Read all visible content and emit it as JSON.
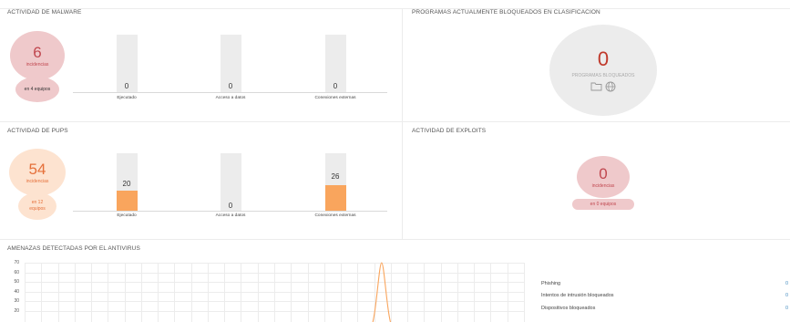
{
  "panels": {
    "malware": {
      "title": "ACTIVIDAD DE MALWARE",
      "count": "6",
      "count_label": "incidencias",
      "devices": "en 4 equipos",
      "bars": [
        {
          "label": "Ejecutado",
          "value": "0",
          "fill": 0
        },
        {
          "label": "Acceso a datos",
          "value": "0",
          "fill": 0
        },
        {
          "label": "Conexiones externas",
          "value": "0",
          "fill": 0
        }
      ]
    },
    "blocked": {
      "title": "PROGRAMAS ACTUALMENTE BLOQUEADOS EN CLASIFICACION",
      "count": "0",
      "label": "PROGRAMAS BLOQUEADOS"
    },
    "pups": {
      "title": "ACTIVIDAD DE PUPS",
      "count": "54",
      "count_label": "incidencias",
      "devices": "en 12 equipos",
      "bars": [
        {
          "label": "Ejecutado",
          "value": "20",
          "fill": 0.35
        },
        {
          "label": "Acceso a datos",
          "value": "0",
          "fill": 0
        },
        {
          "label": "Conexiones externas",
          "value": "26",
          "fill": 0.45
        }
      ]
    },
    "exploits": {
      "title": "ACTIVIDAD DE EXPLOITS",
      "count": "0",
      "count_label": "incidencias",
      "devices": "en 0 equipos"
    },
    "threats": {
      "title": "AMENAZAS DETECTADAS POR EL ANTIVIRUS",
      "legend": [
        {
          "label": "Phishing",
          "value": "0"
        },
        {
          "label": "Intentos de intrusión bloqueados",
          "value": "0"
        },
        {
          "label": "Dispositivos bloqueados",
          "value": "0"
        }
      ]
    }
  },
  "chart_data": {
    "type": "line",
    "title": "AMENAZAS DETECTADAS POR EL ANTIVIRUS",
    "y_ticks": [
      "70",
      "60",
      "50",
      "40",
      "30",
      "20"
    ],
    "ylim": [
      15,
      70
    ],
    "series": [
      {
        "color": "#f9a55d",
        "peak_value": 70,
        "peak_at_fraction": 0.715
      }
    ],
    "grid": true
  },
  "colors": {
    "malware_circle": "#efc9cb",
    "malware_text": "#c0474f",
    "pups_circle": "#fde3d0",
    "pups_text": "#e5703a",
    "bar_fill": "#f9a55d",
    "blocked_circle": "#ececec",
    "blocked_text": "#c0392b",
    "legend_value": "#4a90c2"
  }
}
